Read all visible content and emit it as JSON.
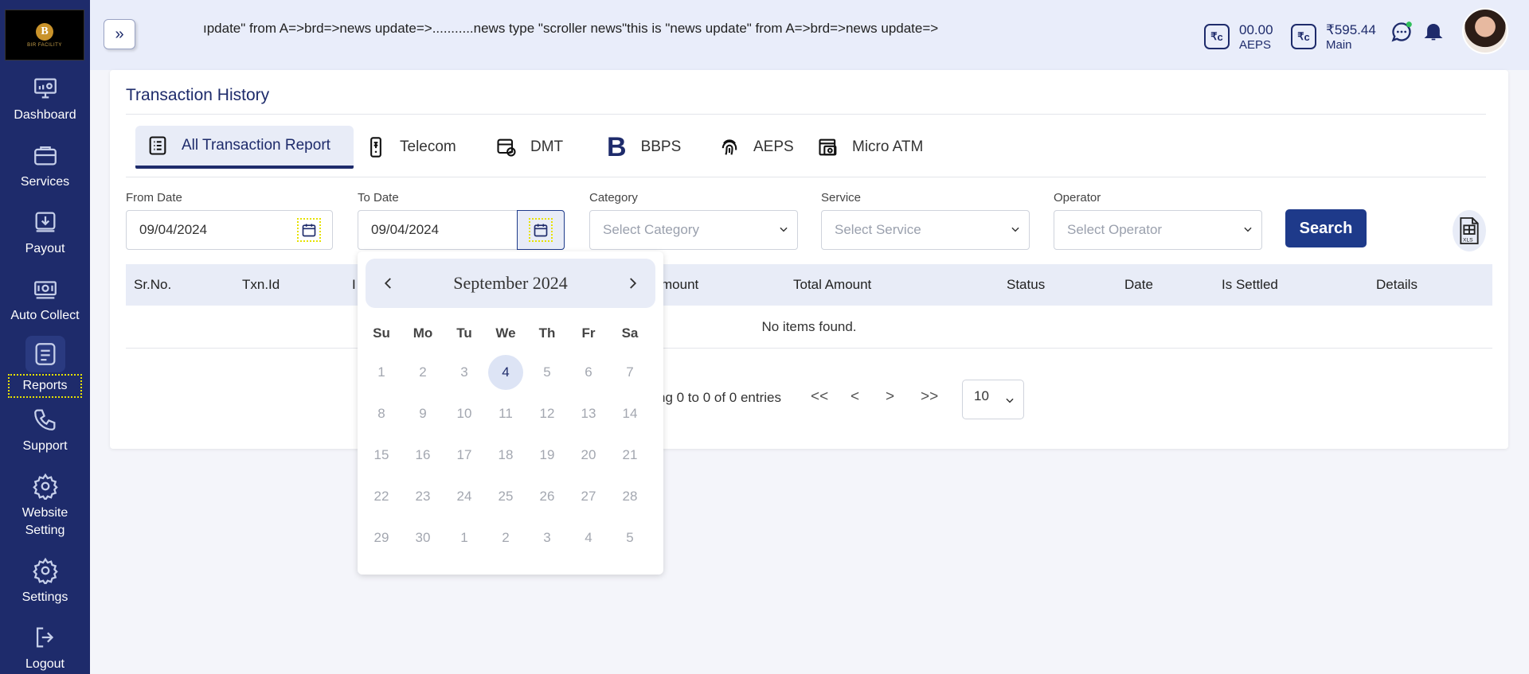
{
  "sidebar": {
    "logo_text": "BIR FACILITY",
    "logo_letter": "B",
    "items": [
      {
        "label": "Dashboard",
        "icon": "monitor-icon"
      },
      {
        "label": "Services",
        "icon": "briefcase-icon"
      },
      {
        "label": "Payout",
        "icon": "payout-icon"
      },
      {
        "label": "Auto Collect",
        "icon": "auto-collect-icon"
      },
      {
        "label": "Reports",
        "icon": "reports-icon",
        "active": true
      },
      {
        "label": "Support",
        "icon": "phone-icon"
      },
      {
        "label": "Website Setting",
        "icon": "gear-icon"
      },
      {
        "label": "Settings",
        "icon": "gear-icon"
      },
      {
        "label": "Logout",
        "icon": "logout-icon"
      }
    ]
  },
  "topbar": {
    "ticker": "ıpdate\" from A=>brd=>news update=>...........news type \"scroller news\"this is \"news update\" from A=>brd=>news update=>",
    "wallets": [
      {
        "amount": "00.00",
        "label": "AEPS",
        "icon_text": "₹"
      },
      {
        "amount": "₹595.44",
        "label": "Main",
        "icon_text": "₹"
      }
    ]
  },
  "page": {
    "title": "Transaction History",
    "tabs": [
      {
        "label": "All Transaction Report",
        "active": true
      },
      {
        "label": "Telecom"
      },
      {
        "label": "DMT"
      },
      {
        "label": "BBPS"
      },
      {
        "label": "AEPS"
      },
      {
        "label": "Micro ATM"
      }
    ],
    "filters": {
      "from_date_label": "From Date",
      "from_date_value": "09/04/2024",
      "to_date_label": "To Date",
      "to_date_value": "09/04/2024",
      "category_label": "Category",
      "category_placeholder": "Select Category",
      "service_label": "Service",
      "service_placeholder": "Select Service",
      "operator_label": "Operator",
      "operator_placeholder": "Select Operator",
      "search_label": "Search"
    },
    "table": {
      "columns": [
        "Sr.No.",
        "Txn.Id",
        "I",
        "mount",
        "Total Amount",
        "Status",
        "Date",
        "Is Settled",
        "Details"
      ],
      "empty_text": "No items found."
    },
    "pagination": {
      "entries_text": "ng 0 to 0 of 0 entries",
      "first": "<<",
      "prev": "<",
      "next": ">",
      "last": ">>",
      "page_size": "10"
    }
  },
  "datepicker": {
    "month": "September",
    "year": "2024",
    "weekdays": [
      "Su",
      "Mo",
      "Tu",
      "We",
      "Th",
      "Fr",
      "Sa"
    ],
    "weeks": [
      [
        "1",
        "2",
        "3",
        "4",
        "5",
        "6",
        "7"
      ],
      [
        "8",
        "9",
        "10",
        "11",
        "12",
        "13",
        "14"
      ],
      [
        "15",
        "16",
        "17",
        "18",
        "19",
        "20",
        "21"
      ],
      [
        "22",
        "23",
        "24",
        "25",
        "26",
        "27",
        "28"
      ],
      [
        "29",
        "30",
        "1",
        "2",
        "3",
        "4",
        "5"
      ]
    ],
    "selected_day": "4"
  },
  "colors": {
    "sidebar_bg": "#1e2b6b",
    "accent": "#1e3a8a",
    "tab_bg": "#e8ecf7"
  }
}
